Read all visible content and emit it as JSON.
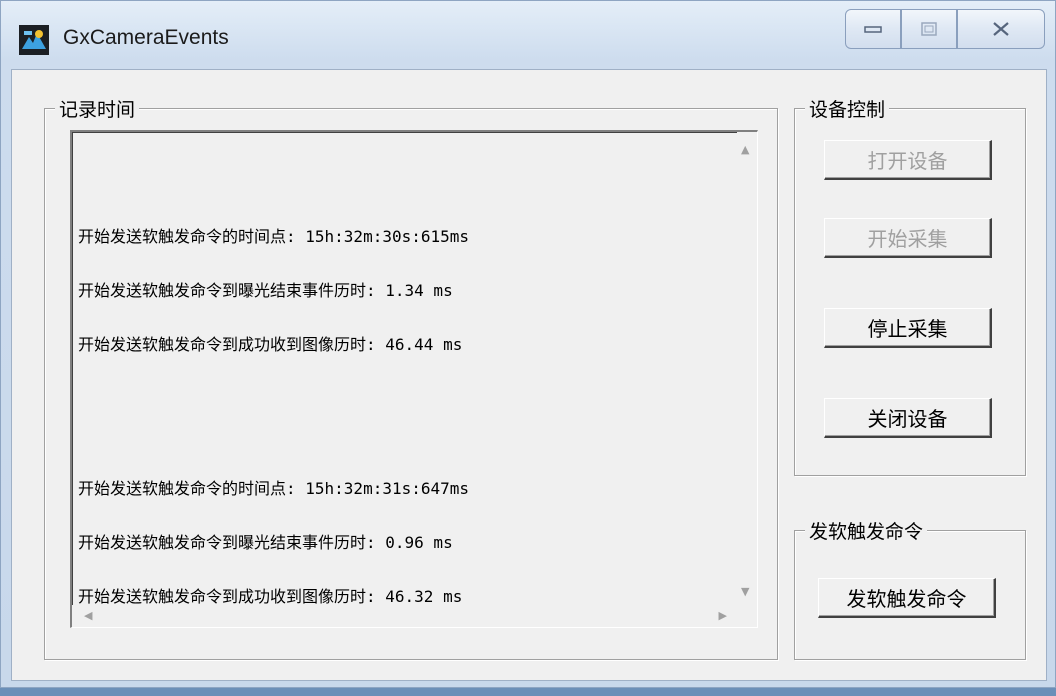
{
  "window": {
    "title": "GxCameraEvents",
    "min_icon": "minimize-icon",
    "max_icon": "maximize-icon",
    "close_icon": "close-icon"
  },
  "log_group": {
    "label": "记录时间",
    "entries": [
      {
        "line1": "开始发送软触发命令的时间点: 15h:32m:30s:615ms",
        "line2": "开始发送软触发命令到曝光结束事件历时: 1.34 ms",
        "line3": "开始发送软触发命令到成功收到图像历时: 46.44 ms"
      },
      {
        "line1": "开始发送软触发命令的时间点: 15h:32m:31s:647ms",
        "line2": "开始发送软触发命令到曝光结束事件历时: 0.96 ms",
        "line3": "开始发送软触发命令到成功收到图像历时: 46.32 ms"
      }
    ]
  },
  "device_group": {
    "label": "设备控制",
    "open_label": "打开设备",
    "start_label": "开始采集",
    "stop_label": "停止采集",
    "close_label": "关闭设备"
  },
  "trigger_group": {
    "label": "发软触发命令",
    "button_label": "发软触发命令"
  },
  "colors": {
    "window_frame": "#c8d8eb",
    "client_bg": "#f0f0f0",
    "disabled_text": "#a0a0a0"
  }
}
